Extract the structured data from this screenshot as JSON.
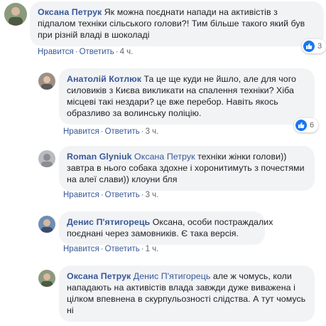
{
  "action_labels": {
    "like": "Нравится",
    "reply": "Ответить"
  },
  "comments": [
    {
      "author": "Оксана Петрук",
      "lines": [
        "Як можна поєднати напади на активістів з",
        "підпалом техніки сільського голови?! Тим більше такого який був",
        "при різній владі в шоколаді"
      ],
      "time": "4 ч.",
      "reactions": "3"
    },
    {
      "author": "Анатолій Котлюк",
      "lines": [
        "Та це ще куди не йшло, але для чого",
        "силовиків з Києва викликати на спалення техніки? Хіба",
        "місцеві такі нездари? це вже перебор. Навіть якось",
        "образливо за волинську поліцію."
      ],
      "time": "3 ч.",
      "reactions": "6"
    },
    {
      "author": "Roman Glyniuk",
      "mention": "Оксана Петрук",
      "first_text": "техніки жінки голови))",
      "lines": [
        "завтра в нього собака здохне і хоронитимуть з почестями",
        "на алеї слави)) клоуни бля"
      ],
      "time": "3 ч."
    },
    {
      "author": "Денис П'ятигорець",
      "first_text": "Оксана, особи постраждалих",
      "lines": [
        "поєднані через замовників. Є така версія."
      ],
      "time": "1 ч."
    },
    {
      "author": "Оксана Петрук",
      "mention": "Денис П'ятигорець",
      "first_text": "але ж чомусь, коли",
      "lines": [
        "нападають на активістів влада завжди дуже виважена і",
        "цілком впевнена в скурпульозності слідства. А тут чомусь",
        "ні"
      ]
    }
  ],
  "colors": {
    "link": "#385898",
    "bubble": "#f2f3f5",
    "meta": "#606770",
    "like": "#1877f2"
  }
}
